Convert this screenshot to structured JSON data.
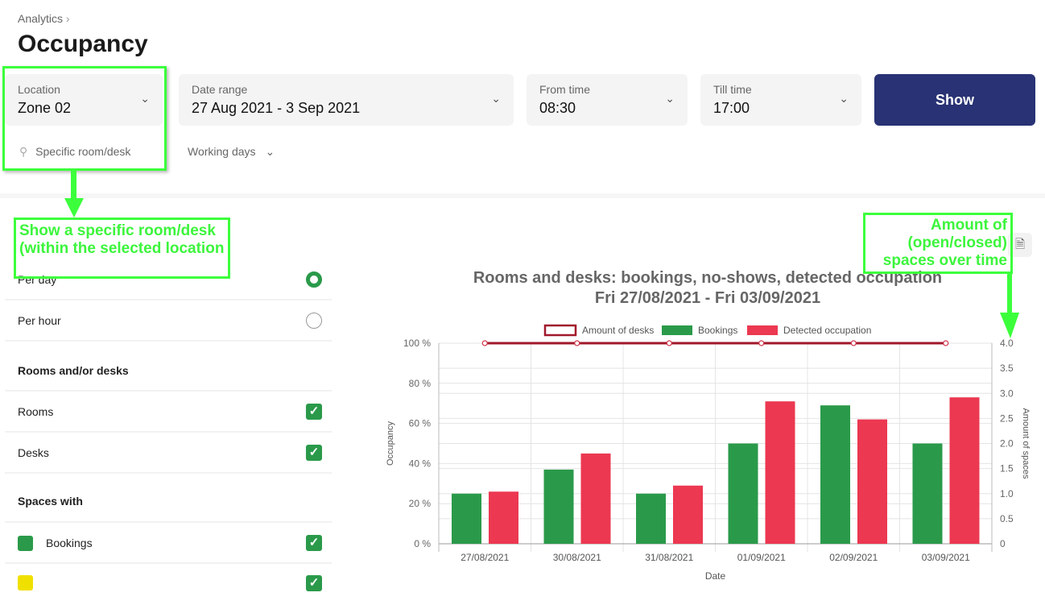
{
  "breadcrumb": {
    "label": "Analytics",
    "chevron": ">"
  },
  "page_title": "Occupancy",
  "filters": {
    "location": {
      "label": "Location",
      "value": "Zone 02"
    },
    "date_range": {
      "label": "Date range",
      "value": "27 Aug 2021 - 3 Sep 2021"
    },
    "from_time": {
      "label": "From time",
      "value": "08:30"
    },
    "till_time": {
      "label": "Till time",
      "value": "17:00"
    },
    "show_label": "Show",
    "search_placeholder": "Specific room/desk",
    "working_days": "Working days"
  },
  "sidebar": {
    "per_day": "Per day",
    "per_hour": "Per hour",
    "selected": "Per day",
    "rooms_desks_heading": "Rooms and/or desks",
    "rooms": "Rooms",
    "desks": "Desks",
    "spaces_heading": "Spaces with",
    "bookings": "Bookings",
    "bookings_color": "#2a9a4a",
    "noshow_color": "#f0e000"
  },
  "annotations": {
    "left": "Show a specific room/desk (within the selected location",
    "right": "Amount of (open/closed) spaces over time"
  },
  "chart_data": {
    "type": "bar",
    "title": "Rooms and desks: bookings, no-shows, detected occupation",
    "subtitle": "Fri 27/08/2021 - Fri 03/09/2021",
    "xlabel": "Date",
    "ylabel": "Occupancy",
    "y2label": "Amount of spaces",
    "categories": [
      "27/08/2021",
      "30/08/2021",
      "31/08/2021",
      "01/09/2021",
      "02/09/2021",
      "03/09/2021"
    ],
    "ylim": [
      0,
      100
    ],
    "y2lim": [
      0,
      4
    ],
    "yticks": [
      "0 %",
      "20 %",
      "40 %",
      "60 %",
      "80 %",
      "100 %"
    ],
    "y2ticks": [
      "0",
      "0.5",
      "1.0",
      "1.5",
      "2.0",
      "2.5",
      "3.0",
      "3.5",
      "4.0"
    ],
    "legend_position": "top",
    "grid": true,
    "series": [
      {
        "name": "Amount of desks",
        "type": "line",
        "axis": "right",
        "color": "#a0182a",
        "values": [
          4,
          4,
          4,
          4,
          4,
          4
        ]
      },
      {
        "name": "Bookings",
        "type": "bar",
        "color": "#2a9a4a",
        "values": [
          25,
          37,
          25,
          50,
          69,
          50
        ]
      },
      {
        "name": "Detected occupation",
        "type": "bar",
        "color": "#ec3851",
        "values": [
          26,
          45,
          29,
          71,
          62,
          73
        ]
      }
    ]
  }
}
